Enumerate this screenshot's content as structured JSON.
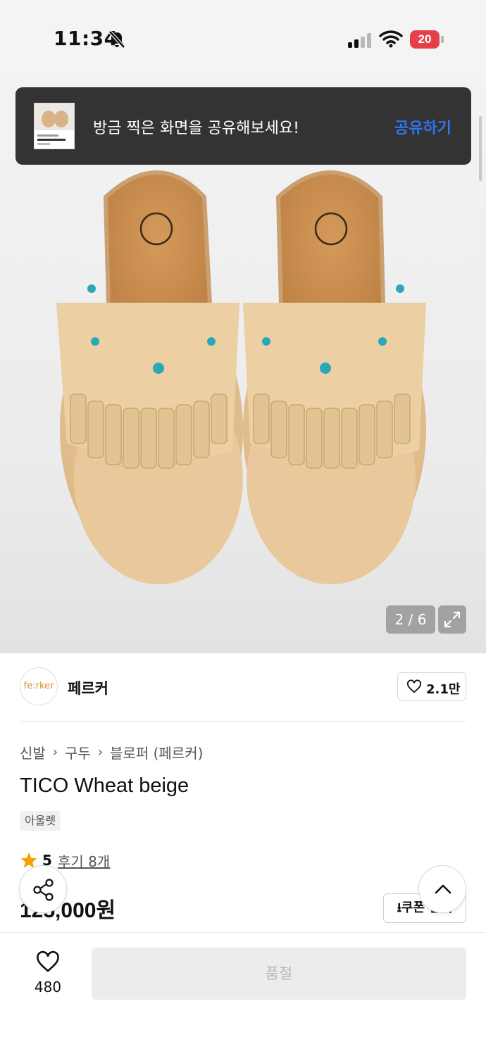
{
  "status_bar": {
    "time": "11:34",
    "battery": "20"
  },
  "toast": {
    "message": "방금 찍은 화면을 공유해보세요!",
    "action": "공유하기"
  },
  "gallery": {
    "counter": "2 / 6"
  },
  "brand": {
    "logo_text": "fe:rker",
    "name": "페르커",
    "likes": "2.1만"
  },
  "product": {
    "breadcrumb": [
      "신발",
      "구두",
      "블로퍼 (페르커)"
    ],
    "title": "TICO Wheat beige",
    "tag": "아울렛",
    "rating": "5",
    "reviews": "후기 8개",
    "price": "125,000원",
    "coupon_label": "쿠폰 받기"
  },
  "bottom_bar": {
    "wish_count": "480",
    "buy_label": "품절"
  },
  "colors": {
    "accent_blue": "#2f74f0",
    "star": "#f5a000",
    "brand_logo": "#e08a2c",
    "battery": "#e5404a"
  }
}
